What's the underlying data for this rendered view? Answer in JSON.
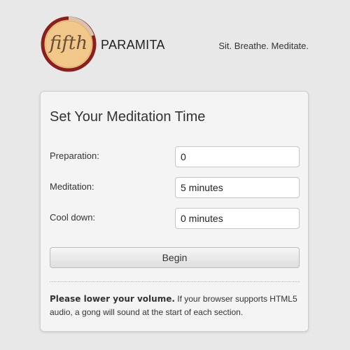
{
  "header": {
    "logo_text": "fifth",
    "brand": "PARAMITA",
    "tagline": "Sit. Breathe. Meditate.",
    "logo_colors": {
      "ring_dark": "#8a1f1f",
      "ring_light": "#d9c2b0",
      "fill": "#f1c88a"
    }
  },
  "card": {
    "title": "Set Your Meditation Time",
    "fields": [
      {
        "label": "Preparation:",
        "value": "0"
      },
      {
        "label": "Meditation:",
        "value": "5 minutes"
      },
      {
        "label": "Cool down:",
        "value": "0 minutes"
      }
    ],
    "begin_label": "Begin",
    "notice_bold": "Please lower your volume.",
    "notice_text": " If your browser supports HTML5 audio, a gong will sound at the start of each section."
  }
}
